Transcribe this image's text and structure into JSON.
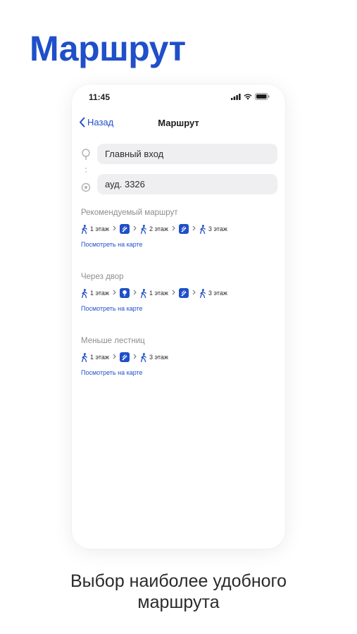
{
  "hero_title": "Маршрут",
  "status_bar": {
    "time": "11:45"
  },
  "nav": {
    "back_label": "Назад",
    "title": "Маршрут"
  },
  "from_field": {
    "value": "Главный вход"
  },
  "to_field": {
    "value": "ауд. 3326"
  },
  "routes": [
    {
      "name": "Рекомендуемый маршрут",
      "steps": [
        {
          "kind": "walk",
          "label": "1 этаж"
        },
        {
          "kind": "stairs"
        },
        {
          "kind": "walk",
          "label": "2 этаж"
        },
        {
          "kind": "stairs"
        },
        {
          "kind": "walk",
          "label": "3 этаж"
        }
      ],
      "map_link": "Посмотреть на карте"
    },
    {
      "name": "Через двор",
      "steps": [
        {
          "kind": "walk",
          "label": "1 этаж"
        },
        {
          "kind": "outdoor"
        },
        {
          "kind": "walk",
          "label": "1 этаж"
        },
        {
          "kind": "stairs"
        },
        {
          "kind": "walk",
          "label": "3 этаж"
        }
      ],
      "map_link": "Посмотреть на карте"
    },
    {
      "name": "Меньше лестниц",
      "steps": [
        {
          "kind": "walk",
          "label": "1 этаж"
        },
        {
          "kind": "stairs"
        },
        {
          "kind": "walk",
          "label": "3 этаж"
        }
      ],
      "map_link": "Посмотреть на карте"
    }
  ],
  "footer_caption": {
    "line1": "Выбор наиболее удобного",
    "line2": "маршрута"
  },
  "colors": {
    "accent": "#1f4fc9",
    "field_bg": "#efeff1",
    "muted_text": "#8e8e93"
  },
  "icons": {
    "walk": "walking-person-icon",
    "stairs": "stairs-icon",
    "outdoor": "tree-icon",
    "separator": "chevron-right-icon"
  }
}
